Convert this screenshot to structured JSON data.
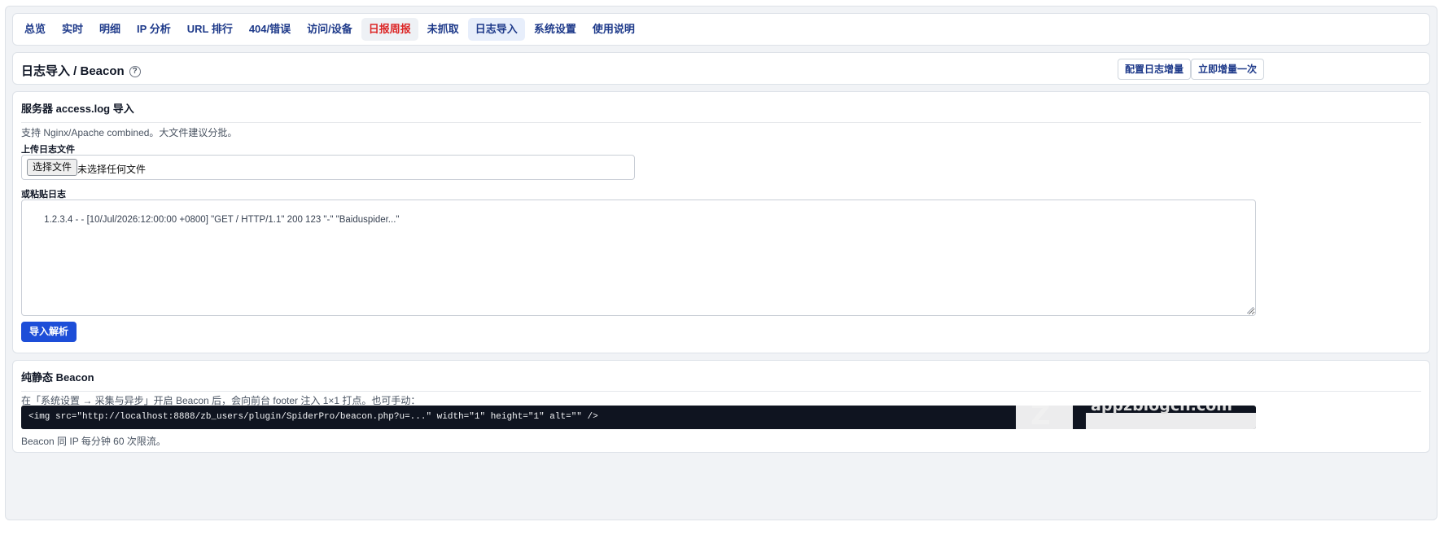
{
  "nav": {
    "tabs": [
      {
        "label": "总览"
      },
      {
        "label": "实时"
      },
      {
        "label": "明细"
      },
      {
        "label": "IP 分析"
      },
      {
        "label": "URL 排行"
      },
      {
        "label": "404/错误"
      },
      {
        "label": "访问/设备"
      },
      {
        "label": "日报周报"
      },
      {
        "label": "未抓取"
      },
      {
        "label": "日志导入"
      },
      {
        "label": "系统设置"
      },
      {
        "label": "使用说明"
      }
    ],
    "highlighted_tab": "日报周报",
    "active_tab": "日志导入"
  },
  "header": {
    "title": "日志导入 / Beacon",
    "help_icon": "?",
    "buttons": {
      "configure": "配置日志增量",
      "run_now": "立即增量一次"
    }
  },
  "import_section": {
    "title": "服务器 access.log 导入",
    "description": "支持 Nginx/Apache combined。大文件建议分批。",
    "upload_label": "上传日志文件",
    "file_button": "选择文件",
    "file_status": "未选择任何文件",
    "paste_label": "或粘贴日志",
    "paste_value": "1.2.3.4 - - [10/Jul/2026:12:00:00 +0800] \"GET / HTTP/1.1\" 200 123 \"-\" \"Baiduspider...\"",
    "submit_button": "导入解析"
  },
  "beacon_section": {
    "title": "纯静态 Beacon",
    "description": "在「系统设置 → 采集与异步」开启 Beacon 后，会向前台 footer 注入 1×1 打点。也可手动：",
    "code": "<img src=\"http://localhost:8888/zb_users/plugin/SpiderPro/beacon.php?u=...\" width=\"1\" height=\"1\" alt=\"\" />",
    "note": "Beacon 同 IP 每分钟 60 次限流。",
    "watermark_text": "appzblogcn.com"
  },
  "colors": {
    "nav_text": "#1e3a8a",
    "highlight_text": "#dc2626",
    "primary": "#1d4ed8",
    "code_bg": "#0f1420"
  }
}
